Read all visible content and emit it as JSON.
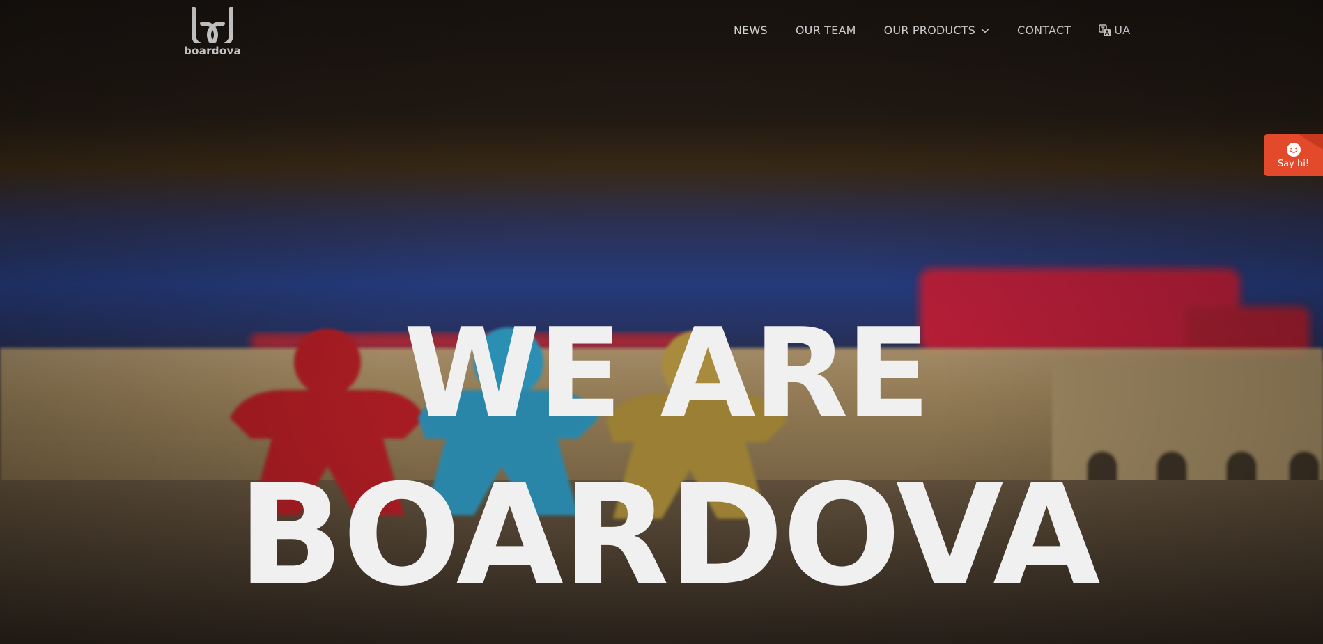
{
  "header": {
    "logo_text": "boardova",
    "nav": [
      {
        "label": "NEWS"
      },
      {
        "label": "OUR TEAM"
      },
      {
        "label": "OUR PRODUCTS",
        "has_dropdown": true
      },
      {
        "label": "CONTACT"
      },
      {
        "label": "UA",
        "icon": "translate-icon"
      }
    ]
  },
  "hero": {
    "line1": "WE ARE",
    "line2": "BOARDOVA"
  },
  "chat_widget": {
    "label": "Say hi!",
    "icon": "smiley-icon",
    "color": "#e24a2b"
  }
}
